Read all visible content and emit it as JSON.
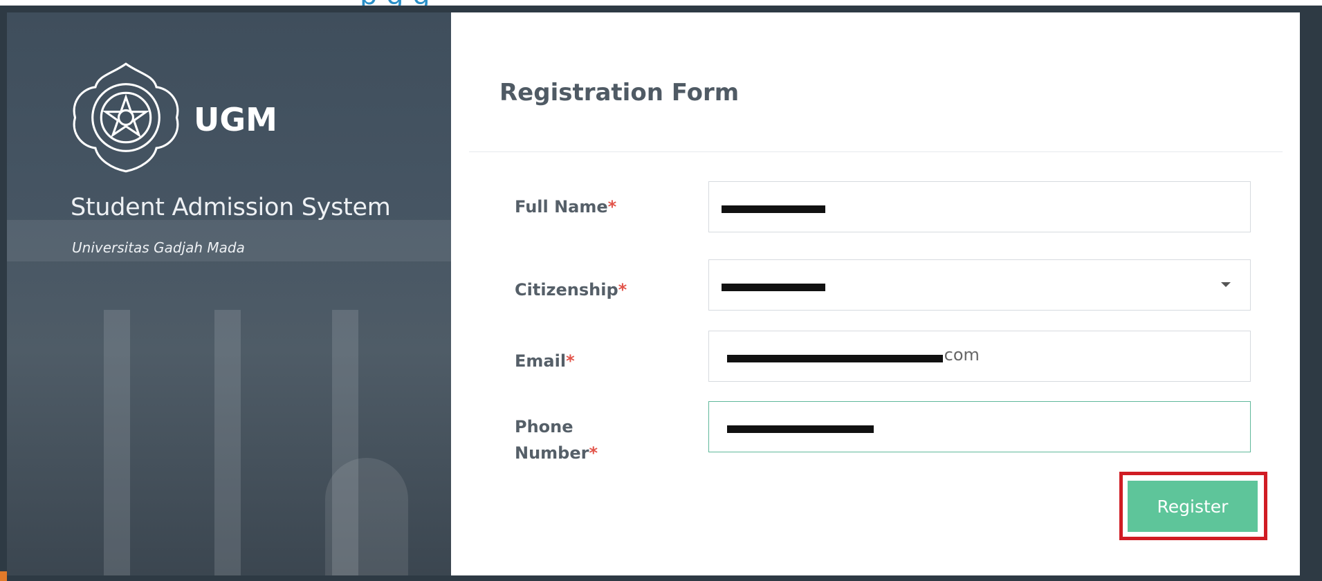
{
  "header": {
    "cropped_heading": "p                    g                                    g"
  },
  "left_panel": {
    "brand": "UGM",
    "system_title": "Student Admission System",
    "university": "Universitas Gadjah Mada",
    "logo_icon": "ugm-emblem-icon"
  },
  "form": {
    "title": "Registration Form",
    "required_marker": "*",
    "fields": [
      {
        "label": "Full Name",
        "value": ""
      },
      {
        "label": "Citizenship",
        "value": "",
        "type": "select"
      },
      {
        "label": "Email",
        "value": ".com"
      },
      {
        "label_line1": "Phone",
        "label_line2": "Number",
        "value": ""
      }
    ],
    "register_label": "Register"
  },
  "colors": {
    "accent_green": "#5ec59a",
    "highlight_red": "#d01c24",
    "required_red": "#e2544a",
    "panel_dark": "#465563"
  }
}
